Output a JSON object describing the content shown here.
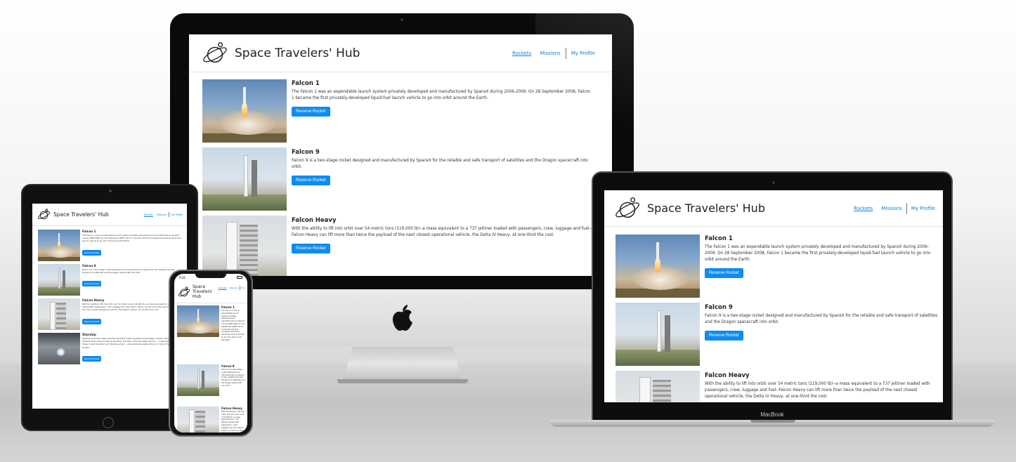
{
  "site": {
    "title": "Space Travelers' Hub",
    "title_line1": "Space",
    "title_line2": "Travelers'",
    "title_line3": "Hub",
    "nav": {
      "rockets": "Rockets",
      "missions": "Missions",
      "profile": "My Profile"
    },
    "reserve_label": "Reserve Rocket",
    "rockets": [
      {
        "name": "Falcon 1",
        "description": "The Falcon 1 was an expendable launch system privately developed and manufactured by SpaceX during 2006-2009. On 28 September 2008, Falcon 1 became the first privately-developed liquid-fuel launch vehicle to go into orbit around the Earth."
      },
      {
        "name": "Falcon 9",
        "description": "Falcon 9 is a two-stage rocket designed and manufactured by SpaceX for the reliable and safe transport of satellites and the Dragon spacecraft into orbit."
      },
      {
        "name": "Falcon Heavy",
        "description": "With the ability to lift into orbit over 54 metric tons (119,000 lb)--a mass equivalent to a 737 jetliner loaded with passengers, crew, luggage and fuel--Falcon Heavy can lift more than twice the payload of the next closest operational vehicle, the Delta IV Heavy, at one-third the cost."
      },
      {
        "name": "Starship",
        "description": "Starship and Super Heavy Rocket represent a fully reusable transportation system designed to service all Earth orbit needs as well as the Moon and Mars. This two-stage vehicle — composed of the Super Heavy rocket (booster) and Starship (ship) — will eventually replace Falcon 9, Falcon Heavy and Dragon."
      }
    ]
  },
  "devices": {
    "laptop_brand": "MacBook",
    "phone_time": "9:41"
  },
  "colors": {
    "link": "#0a84d8",
    "button": "#0d8cf2"
  }
}
